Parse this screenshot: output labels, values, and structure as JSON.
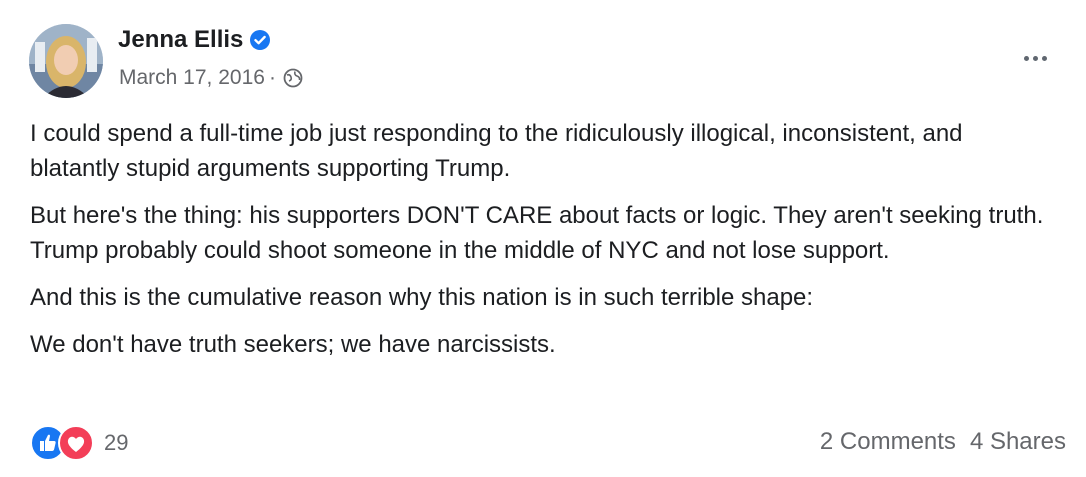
{
  "post": {
    "author": "Jenna Ellis",
    "date": "March 17, 2016",
    "separator": "·",
    "paragraphs": [
      "I could spend a full-time job just responding to the ridiculously illogical, inconsistent, and blatantly stupid arguments supporting Trump.",
      "But here's the thing: his supporters DON'T CARE about facts or logic. They aren't seeking truth. Trump probably could shoot someone in the middle of NYC and not lose support.",
      "And this is the cumulative reason why this nation is in such terrible shape:",
      "We don't have truth seekers; we have narcissists."
    ],
    "reactions": {
      "count": "29",
      "icons": [
        "like-icon",
        "love-icon"
      ]
    },
    "stats": {
      "comments": "2 Comments",
      "shares": "4 Shares"
    }
  },
  "colors": {
    "verified": "#1877f2",
    "like": "#1877f2",
    "love": "#f33e58",
    "muted": "#65676b"
  }
}
